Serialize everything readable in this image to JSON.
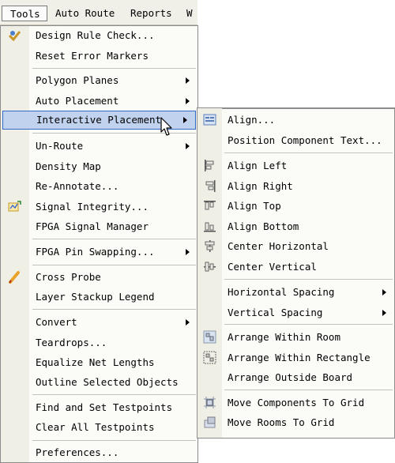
{
  "menubar": {
    "tools": "Tools",
    "auto_route": "Auto Route",
    "reports": "Reports",
    "w": "W"
  },
  "tools_menu": {
    "items": [
      {
        "label": "Design Rule Check...",
        "icon": "design-rule-check-icon"
      },
      {
        "label": "Reset Error Markers"
      },
      {
        "label": "Polygon Planes",
        "submenu": true
      },
      {
        "label": "Auto Placement",
        "submenu": true
      },
      {
        "label": "Interactive Placement",
        "submenu": true,
        "selected": true
      },
      {
        "label": "Un-Route",
        "submenu": true
      },
      {
        "label": "Density Map"
      },
      {
        "label": "Re-Annotate..."
      },
      {
        "label": "Signal Integrity...",
        "icon": "signal-integrity-icon"
      },
      {
        "label": "FPGA Signal Manager"
      },
      {
        "label": "FPGA Pin Swapping...",
        "submenu": true
      },
      {
        "label": "Cross Probe",
        "icon": "cross-probe-icon"
      },
      {
        "label": "Layer Stackup Legend"
      },
      {
        "label": "Convert",
        "submenu": true
      },
      {
        "label": "Teardrops..."
      },
      {
        "label": "Equalize Net Lengths"
      },
      {
        "label": "Outline Selected Objects"
      },
      {
        "label": "Find and Set Testpoints"
      },
      {
        "label": "Clear All Testpoints"
      },
      {
        "label": "Preferences..."
      }
    ]
  },
  "interactive_placement_submenu": {
    "items": [
      {
        "label": "Align...",
        "icon": "align-dialog-icon"
      },
      {
        "label": "Position Component Text..."
      },
      {
        "label": "Align Left",
        "icon": "align-left-icon"
      },
      {
        "label": "Align Right",
        "icon": "align-right-icon"
      },
      {
        "label": "Align Top",
        "icon": "align-top-icon"
      },
      {
        "label": "Align Bottom",
        "icon": "align-bottom-icon"
      },
      {
        "label": "Center Horizontal",
        "icon": "center-horizontal-icon"
      },
      {
        "label": "Center Vertical",
        "icon": "center-vertical-icon"
      },
      {
        "label": "Horizontal Spacing",
        "submenu": true
      },
      {
        "label": "Vertical Spacing",
        "submenu": true
      },
      {
        "label": "Arrange Within Room",
        "icon": "arrange-within-room-icon"
      },
      {
        "label": "Arrange Within Rectangle",
        "icon": "arrange-within-rectangle-icon"
      },
      {
        "label": "Arrange Outside Board"
      },
      {
        "label": "Move Components To Grid",
        "icon": "move-components-to-grid-icon"
      },
      {
        "label": "Move Rooms To Grid",
        "icon": "move-rooms-to-grid-icon"
      }
    ]
  }
}
